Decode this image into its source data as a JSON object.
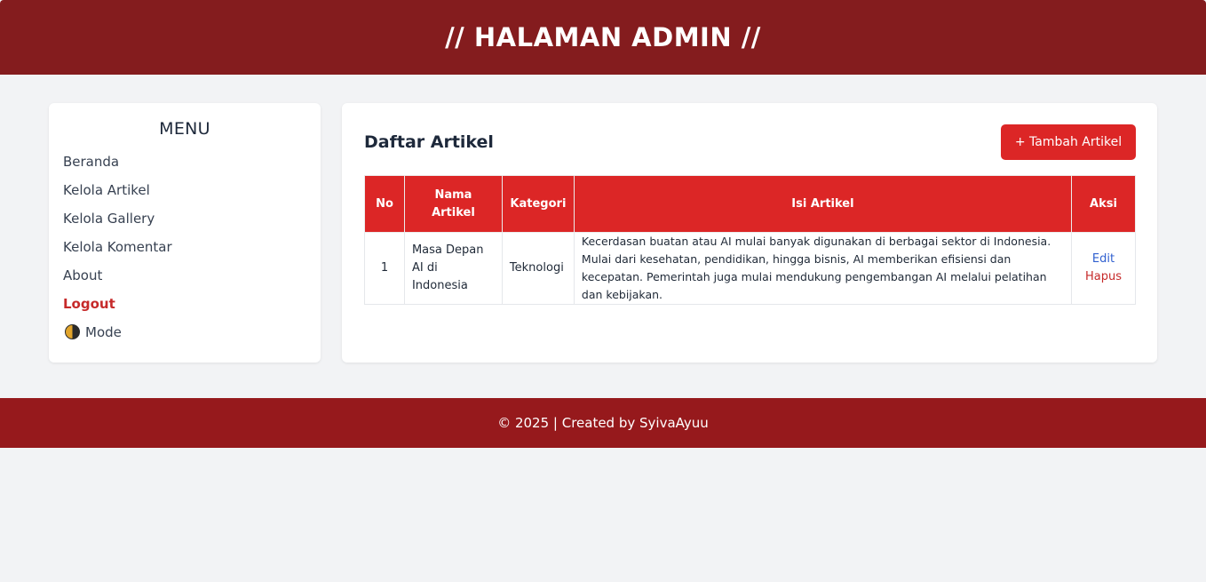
{
  "header": {
    "title": "// HALAMAN ADMIN //"
  },
  "sidebar": {
    "title": "MENU",
    "items": [
      {
        "label": "Beranda"
      },
      {
        "label": "Kelola Artikel"
      },
      {
        "label": "Kelola Gallery"
      },
      {
        "label": "Kelola Komentar"
      },
      {
        "label": "About"
      },
      {
        "label": "Logout"
      },
      {
        "label": "Mode",
        "icon": "half-moon-icon"
      }
    ]
  },
  "main": {
    "title": "Daftar Artikel",
    "add_button": "+ Tambah Artikel",
    "table": {
      "headers": [
        "No",
        "Nama Artikel",
        "Kategori",
        "Isi Artikel",
        "Aksi"
      ],
      "rows": [
        {
          "no": "1",
          "nama": "Masa Depan AI di Indonesia",
          "kategori": "Teknologi",
          "isi": "Kecerdasan buatan atau AI mulai banyak digunakan di berbagai sektor di Indonesia. Mulai dari kesehatan, pendidikan, hingga bisnis, AI memberikan efisiensi dan kecepatan. Pemerintah juga mulai mendukung pengembangan AI melalui pelatihan dan kebijakan.",
          "edit": "Edit",
          "hapus": "Hapus"
        }
      ]
    }
  },
  "footer": {
    "text": "© 2025 | Created by SyivaAyuu"
  },
  "colors": {
    "header_bg": "#841c1e",
    "footer_bg": "#96191c",
    "accent": "#dc2626",
    "logout": "#c62a2a",
    "edit_link": "#2f5fcf"
  }
}
